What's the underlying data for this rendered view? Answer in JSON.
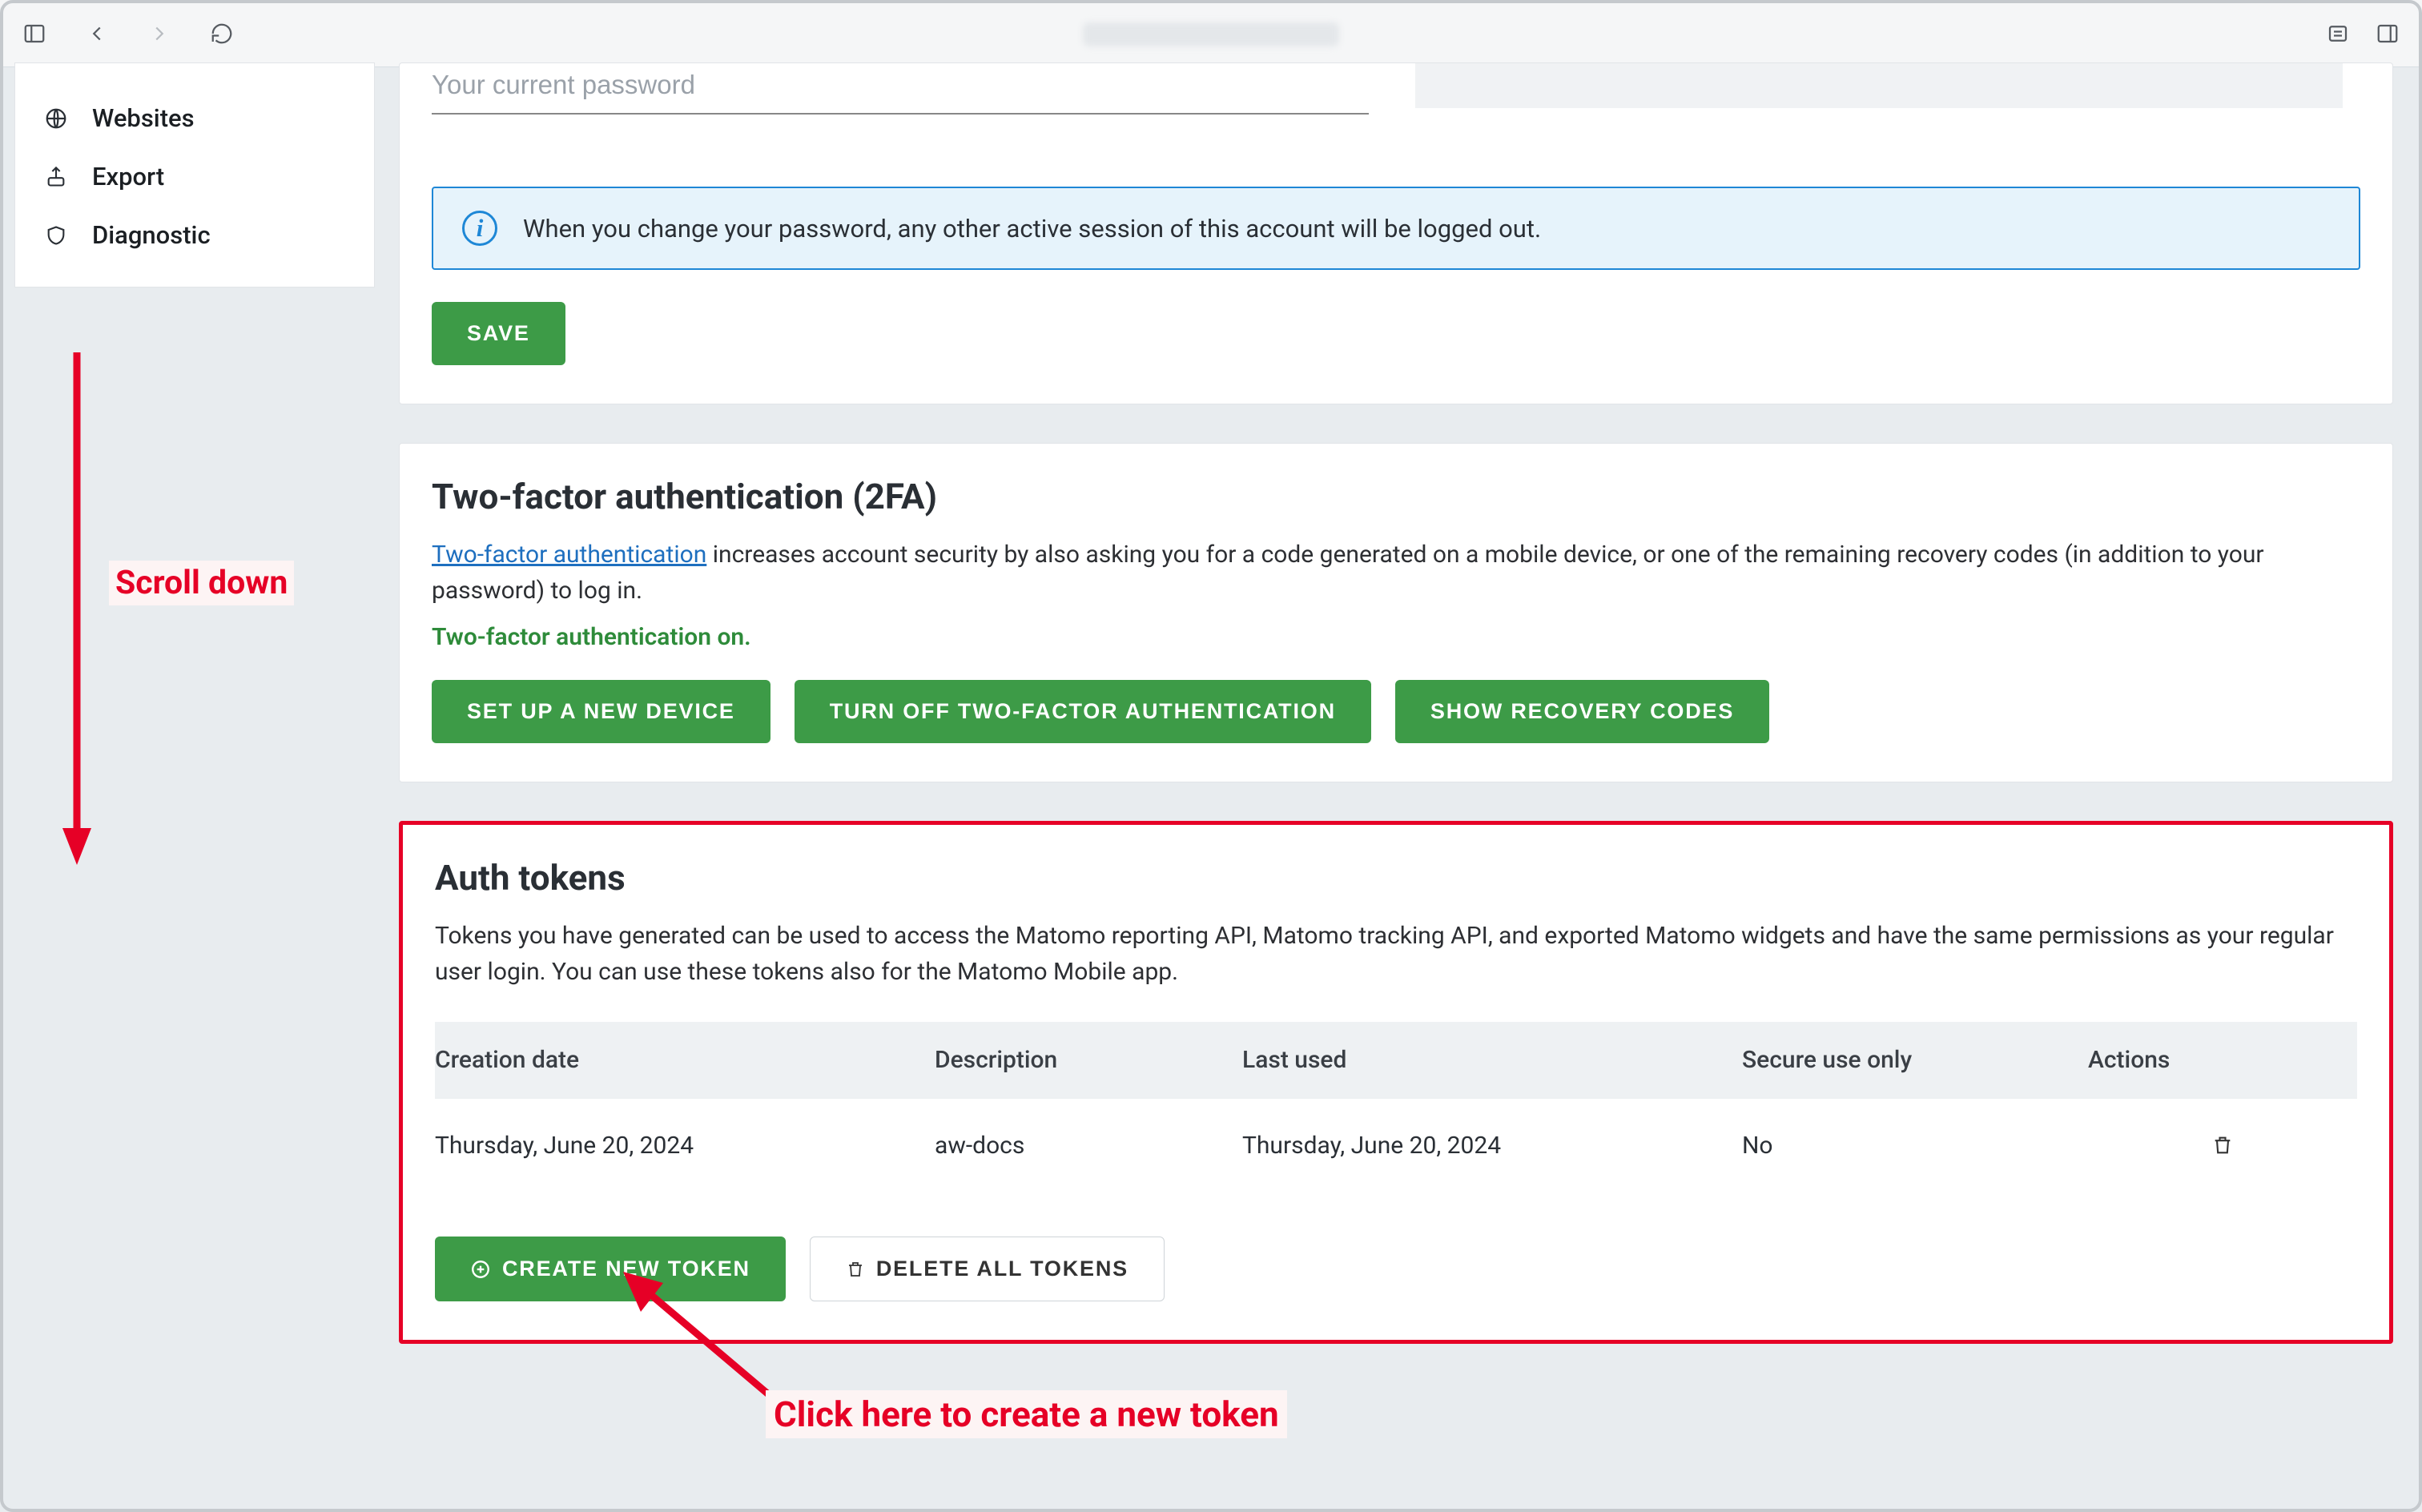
{
  "browser": {
    "url_blurred": true
  },
  "sidebar": {
    "items": [
      {
        "icon": "globe",
        "label": "Websites"
      },
      {
        "icon": "export",
        "label": "Export"
      },
      {
        "icon": "shield",
        "label": "Diagnostic"
      }
    ]
  },
  "password_section": {
    "placeholder": "Your current password",
    "info_text": "When you change your password, any other active session of this account will be logged out.",
    "save_label": "Save"
  },
  "tfa_section": {
    "title": "Two-factor authentication (2FA)",
    "link_text": "Two-factor authentication",
    "desc_tail": " increases account security by also asking you for a code generated on a mobile device, or one of the remaining recovery codes (in addition to your password) to log in.",
    "status": "Two-factor authentication on.",
    "btn_setup": "Set up a new device",
    "btn_turnoff": "Turn off two-factor authentication",
    "btn_recovery": "Show recovery codes"
  },
  "tokens_section": {
    "title": "Auth tokens",
    "desc": "Tokens you have generated can be used to access the Matomo reporting API, Matomo tracking API, and exported Matomo widgets and have the same permissions as your regular user login. You can use these tokens also for the Matomo Mobile app.",
    "headers": {
      "created": "Creation date",
      "description": "Description",
      "last_used": "Last used",
      "secure": "Secure use only",
      "actions": "Actions"
    },
    "rows": [
      {
        "created": "Thursday, June 20, 2024",
        "description": "aw-docs",
        "last_used": "Thursday, June 20, 2024",
        "secure": "No"
      }
    ],
    "btn_create": "Create new token",
    "btn_delete_all": "Delete all tokens"
  },
  "annotations": {
    "scroll": "Scroll down",
    "click": "Click here to create a new token"
  }
}
